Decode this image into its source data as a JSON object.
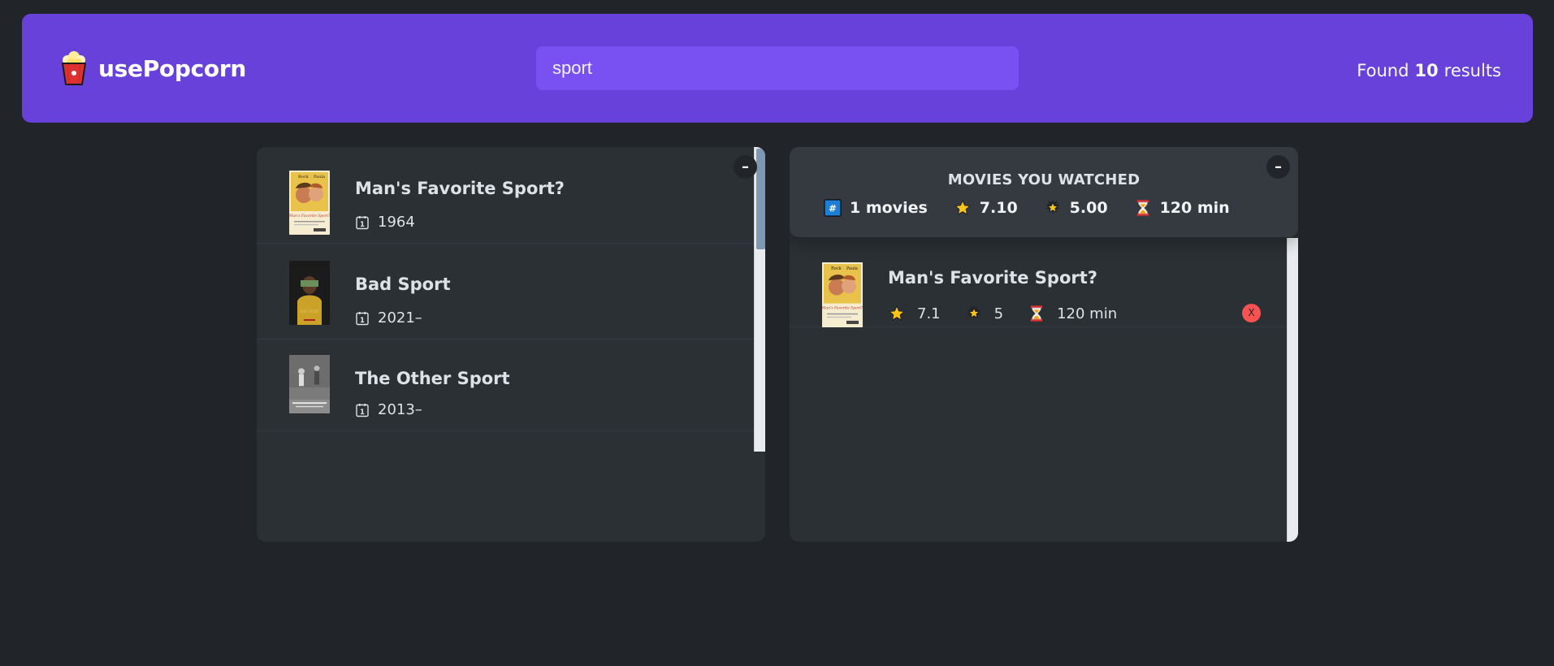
{
  "nav": {
    "logo_icon": "popcorn-icon",
    "app_name": "usePopcorn",
    "search": {
      "value": "sport",
      "placeholder": "Search movies..."
    },
    "results": {
      "prefix": "Found",
      "count": "10",
      "suffix": "results"
    }
  },
  "movie_list": {
    "toggle_label": "–",
    "movies": [
      {
        "title": "Man's Favorite Sport?",
        "year": "1964",
        "icon": "calendar-icon"
      },
      {
        "title": "Bad Sport",
        "year": "2021–",
        "icon": "calendar-icon"
      },
      {
        "title": "The Other Sport",
        "year": "2013–",
        "icon": "calendar-icon"
      }
    ]
  },
  "watched": {
    "toggle_label": "–",
    "summary": {
      "title": "Movies you watched",
      "num_movies": "1 movies",
      "avg_imdb_rating": "7.10",
      "avg_user_rating": "5.00",
      "avg_runtime": "120 min",
      "icons": {
        "count": "hash-icon",
        "imdb": "star-icon",
        "user": "glowing-star-icon",
        "runtime": "hourglass-icon"
      }
    },
    "movies": [
      {
        "title": "Man's Favorite Sport?",
        "imdb_rating": "7.1",
        "user_rating": "5",
        "runtime": "120 min",
        "delete_label": "X"
      }
    ]
  },
  "colors": {
    "nav_bg": "#6741d9",
    "search_bg": "#7950f2",
    "page_bg": "#212529",
    "box_bg": "#2b3035",
    "summary_bg": "#343a40",
    "delete_red": "#fa5252"
  }
}
